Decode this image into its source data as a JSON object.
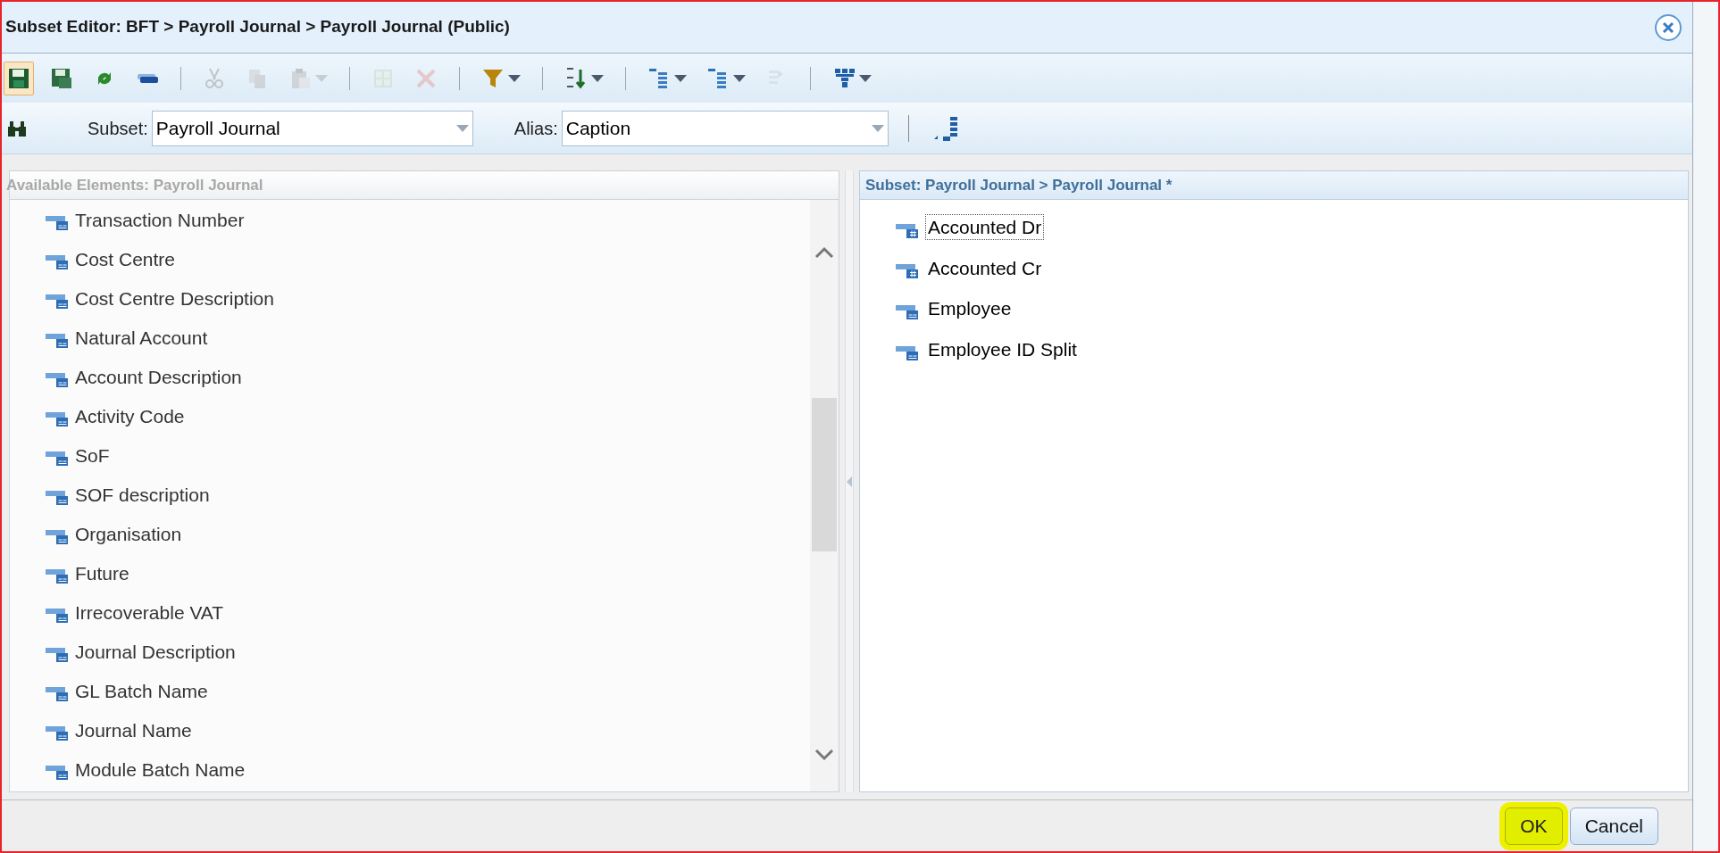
{
  "window": {
    "title": "Subset Editor: BFT > Payroll Journal > Payroll Journal (Public)"
  },
  "toolbar": [
    {
      "kind": "save",
      "disabled": false,
      "selected": true
    },
    {
      "kind": "save-as",
      "disabled": false,
      "selected": false
    },
    {
      "kind": "refresh",
      "disabled": false,
      "selected": false
    },
    {
      "kind": "bar",
      "disabled": false,
      "selected": false
    },
    {
      "kind": "sep"
    },
    {
      "kind": "cut",
      "disabled": true,
      "selected": false
    },
    {
      "kind": "copy",
      "disabled": true,
      "selected": false
    },
    {
      "kind": "paste",
      "disabled": true,
      "selected": false,
      "dropdown": true
    },
    {
      "kind": "sep"
    },
    {
      "kind": "grid",
      "disabled": true,
      "selected": false
    },
    {
      "kind": "delete",
      "disabled": true,
      "selected": false
    },
    {
      "kind": "sep"
    },
    {
      "kind": "filter",
      "disabled": false,
      "selected": false,
      "dropdown": true
    },
    {
      "kind": "sep"
    },
    {
      "kind": "sort",
      "disabled": false,
      "selected": false,
      "dropdown": true
    },
    {
      "kind": "sep"
    },
    {
      "kind": "tree",
      "disabled": false,
      "selected": false,
      "dropdown": true
    },
    {
      "kind": "tree",
      "disabled": false,
      "selected": false,
      "dropdown": true
    },
    {
      "kind": "insert",
      "disabled": true,
      "selected": false
    },
    {
      "kind": "sep"
    },
    {
      "kind": "hierarchy",
      "disabled": false,
      "selected": false,
      "dropdown": true
    }
  ],
  "subset": {
    "label": "Subset:",
    "value": "Payroll Journal"
  },
  "alias": {
    "label": "Alias:",
    "value": "Caption"
  },
  "available": {
    "title": "Available Elements: Payroll Journal",
    "items": [
      {
        "label": "Transaction Number",
        "kind": "text"
      },
      {
        "label": "Cost Centre",
        "kind": "text"
      },
      {
        "label": "Cost Centre Description",
        "kind": "text"
      },
      {
        "label": "Natural Account",
        "kind": "text"
      },
      {
        "label": "Account Description",
        "kind": "text"
      },
      {
        "label": "Activity Code",
        "kind": "text"
      },
      {
        "label": "SoF",
        "kind": "text"
      },
      {
        "label": "SOF description",
        "kind": "text"
      },
      {
        "label": "Organisation",
        "kind": "text"
      },
      {
        "label": "Future",
        "kind": "text"
      },
      {
        "label": "Irrecoverable VAT",
        "kind": "text"
      },
      {
        "label": "Journal Description",
        "kind": "text"
      },
      {
        "label": "GL Batch Name",
        "kind": "text"
      },
      {
        "label": "Journal Name",
        "kind": "text"
      },
      {
        "label": "Module Batch Name",
        "kind": "text"
      }
    ]
  },
  "subset_panel": {
    "title": "Subset: Payroll Journal > Payroll Journal *",
    "items": [
      {
        "label": "Accounted Dr",
        "kind": "numeric",
        "selected": true
      },
      {
        "label": "Accounted Cr",
        "kind": "numeric",
        "selected": false
      },
      {
        "label": "Employee",
        "kind": "text",
        "selected": false
      },
      {
        "label": "Employee ID Split",
        "kind": "text",
        "selected": false
      }
    ]
  },
  "buttons": [
    {
      "label": "OK",
      "kind": "ok"
    },
    {
      "label": "Cancel",
      "kind": "cancel"
    }
  ]
}
